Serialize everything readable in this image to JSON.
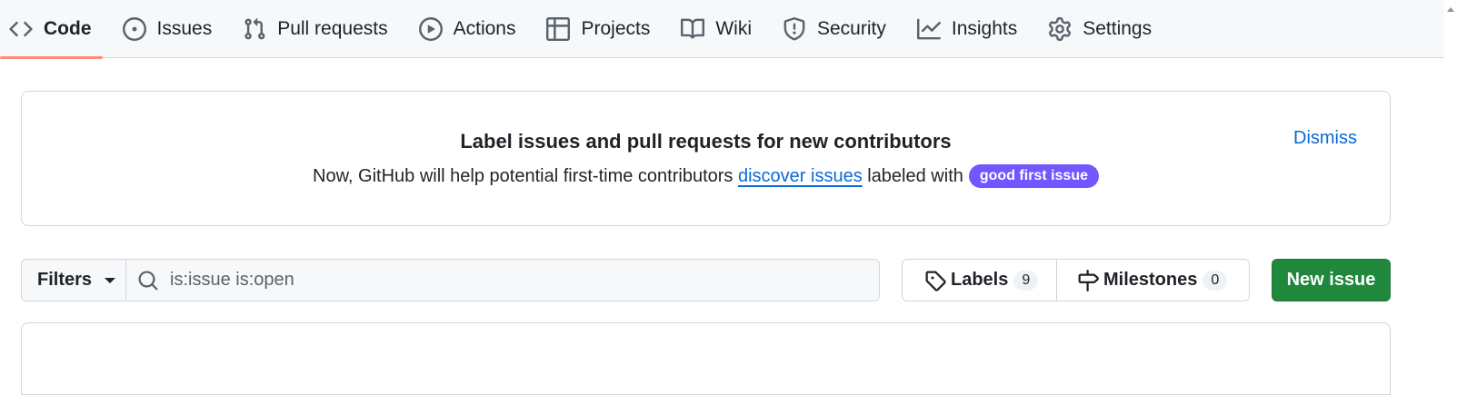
{
  "repo_nav": {
    "items": [
      {
        "label": "Code",
        "icon": "code-icon",
        "selected": true
      },
      {
        "label": "Issues",
        "icon": "issue-opened-icon",
        "selected": false
      },
      {
        "label": "Pull requests",
        "icon": "git-pull-request-icon",
        "selected": false
      },
      {
        "label": "Actions",
        "icon": "play-icon",
        "selected": false
      },
      {
        "label": "Projects",
        "icon": "table-icon",
        "selected": false
      },
      {
        "label": "Wiki",
        "icon": "book-icon",
        "selected": false
      },
      {
        "label": "Security",
        "icon": "shield-icon",
        "selected": false
      },
      {
        "label": "Insights",
        "icon": "graph-icon",
        "selected": false
      },
      {
        "label": "Settings",
        "icon": "gear-icon",
        "selected": false
      }
    ]
  },
  "banner": {
    "title": "Label issues and pull requests for new contributors",
    "body_prefix": "Now, GitHub will help potential first-time contributors ",
    "link_text": "discover issues",
    "body_suffix": " labeled with",
    "label_name": "good first issue",
    "label_color": "#7057ff",
    "dismiss_label": "Dismiss"
  },
  "filter_bar": {
    "filters_label": "Filters",
    "search_value": "is:issue is:open",
    "labels_label": "Labels",
    "labels_count": "9",
    "milestones_label": "Milestones",
    "milestones_count": "0",
    "new_issue_label": "New issue"
  },
  "colors": {
    "accent_link": "#0969da",
    "primary_button": "#1f883d",
    "selected_tab_underline": "#fd8c73"
  }
}
